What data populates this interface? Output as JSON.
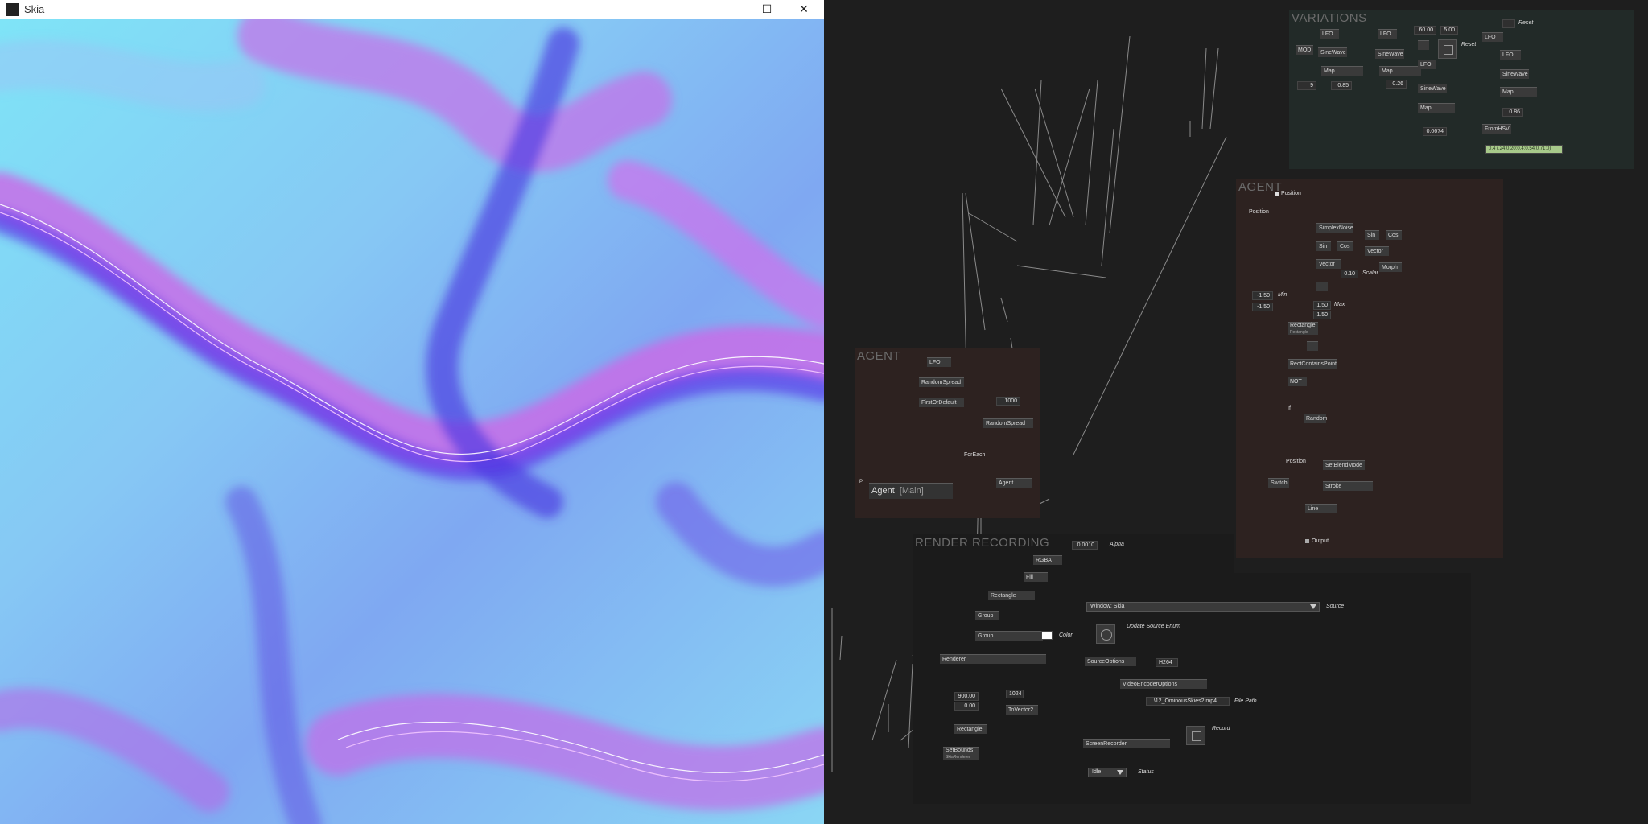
{
  "window": {
    "title": "Skia",
    "minimize": "—",
    "maximize": "☐",
    "close": "✕"
  },
  "regions": {
    "variations": "VARIATIONS",
    "agent_right": "AGENT",
    "agent_left": "AGENT",
    "render": "RENDER RECORDING"
  },
  "variations": {
    "lfo1": "LFO",
    "lfo2": "LFO",
    "lfo3": "LFO",
    "lfo4": "LFO",
    "lfo5": "LFO",
    "mod": "MOD",
    "sinewave1": "SineWave",
    "sinewave2": "SineWave",
    "sinewave3": "SineWave",
    "sinewave4": "SineWave",
    "map1": "Map",
    "map2": "Map",
    "map3": "Map",
    "map4": "Map",
    "v9": "9",
    "v085": "0.85",
    "v026": "0.26",
    "v6000": "60.00",
    "v500": "5.00",
    "v00674": "0.0674",
    "v086": "0.86",
    "reset1": "Reset",
    "reset2": "Reset",
    "fromhsv": "FromHSV",
    "color_value": "0.4 (.24;0.20;0.4;0.54;0.71;0)"
  },
  "agent_right": {
    "position_in": "Position",
    "position": "Position",
    "simplexnoise": "SimplexNoise",
    "sin1": "Sin",
    "cos1": "Cos",
    "sin2": "Sin",
    "cos2": "Cos",
    "vector1": "Vector",
    "vector2": "Vector",
    "v010": "0.10",
    "scalar": "Scalar",
    "morph": "Morph",
    "min1": "-1.50",
    "min2": "-1.50",
    "min_label": "Min",
    "max1": "1.50",
    "max2": "1.50",
    "max_label": "Max",
    "rectangle": "Rectangle",
    "rectangle_sub": "Rectangle",
    "rectcontainspoint": "RectContainsPoint",
    "not": "NOT",
    "if": "If",
    "random": "Random",
    "position2": "Position",
    "setblendmode": "SetBlendMode",
    "switch": "Switch",
    "stroke": "Stroke",
    "line": "Line",
    "output": "Output"
  },
  "agent_left": {
    "lfo": "LFO",
    "randomspread1": "RandomSpread",
    "firstordefault": "FirstOrDefault",
    "v1000": "1000",
    "randomspread2": "RandomSpread",
    "foreach": "ForEach",
    "agent_node": "Agent",
    "pin_p": "P",
    "agent_label": "Agent",
    "agent_main": "[Main]"
  },
  "render": {
    "alpha_value": "0.0010",
    "alpha_label": "Alpha",
    "rgba": "RGBA",
    "fill": "Fill",
    "rectangle1": "Rectangle",
    "group1": "Group",
    "group2": "Group",
    "color_label": "Color",
    "renderer": "Renderer",
    "window_source": "Window: Skia",
    "source_label": "Source",
    "update_source_enum": "Update Source Enum",
    "sourceoptions": "SourceOptions",
    "h264": "H264",
    "videoencoderoptions": "VideoEncoderOptions",
    "filepath_value": "...\\12_OminousSkies2.mp4",
    "filepath_label": "File Path",
    "v900": "900.00",
    "v000": "0.00",
    "v1024": "1024",
    "tovector2": "ToVector2",
    "rectangle2": "Rectangle",
    "setbounds": "SetBounds",
    "setbounds_sub": "SkiaRenderer",
    "screenrecorder": "ScreenRecorder",
    "record_label": "Record",
    "status_value": "Idle",
    "status_label": "Status"
  },
  "colors": {
    "accent_cyan": "#6fe0f5",
    "accent_blue": "#4a3cf0",
    "accent_magenta": "#d86ef0",
    "variations_bg": "#222a28",
    "agent_bg": "#2d2220"
  }
}
